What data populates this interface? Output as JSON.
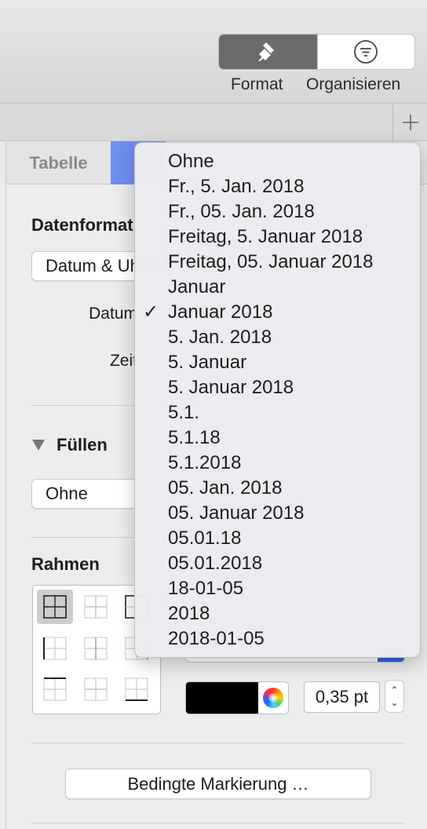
{
  "toolbar": {
    "format_label": "Format",
    "organize_label": "Organisieren",
    "format_icon": "paintbrush-icon",
    "organize_icon": "filter-icon"
  },
  "tabstrip": {
    "add_icon": "plus-icon"
  },
  "inspector": {
    "tabs": {
      "tabelle": "Tabelle"
    },
    "data_format": {
      "title": "Datenformat",
      "popup_value": "Datum & Uhrzeit",
      "date_label": "Datum",
      "time_label": "Zeit"
    },
    "fill": {
      "title": "Füllen",
      "popup_value": "Ohne"
    },
    "border": {
      "title": "Rahmen",
      "color": "#000000",
      "width_value": "0,35 pt"
    },
    "conditional_button": "Bedingte Markierung …"
  },
  "menu": {
    "selected_index": 6,
    "check_mark": "✓",
    "items": [
      "Ohne",
      "Fr., 5. Jan. 2018",
      "Fr., 05. Jan. 2018",
      "Freitag, 5. Januar 2018",
      "Freitag, 05. Januar 2018",
      "Januar",
      "Januar 2018",
      "5. Jan. 2018",
      "5. Januar",
      "5. Januar 2018",
      "5.1.",
      "5.1.18",
      "5.1.2018",
      "05. Jan. 2018",
      "05. Januar 2018",
      "05.01.18",
      "05.01.2018",
      "18-01-05",
      "2018",
      "2018-01-05"
    ]
  },
  "colors": {
    "accent": "#2c63e4",
    "tab_selected": "#6f8ff0"
  }
}
